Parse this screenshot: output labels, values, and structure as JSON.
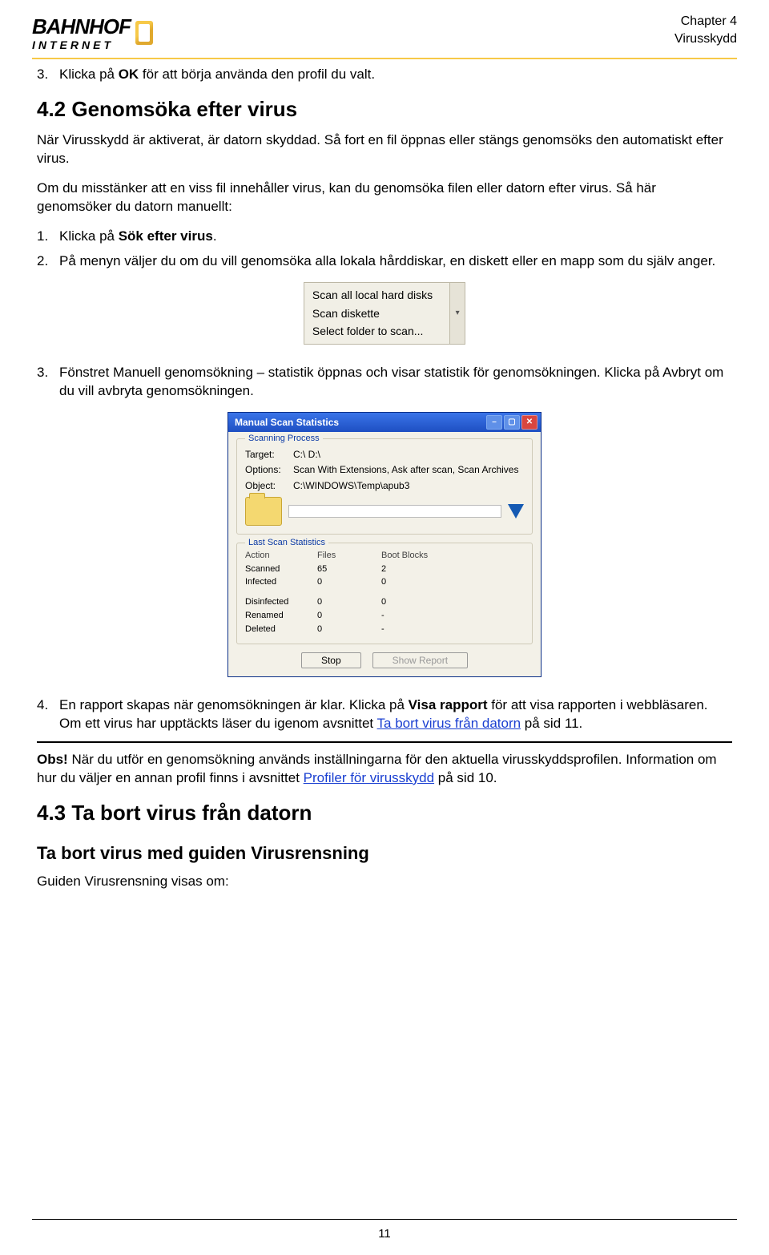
{
  "header": {
    "logo_main": "BAHNHOF",
    "logo_sub": "INTERNET",
    "chapter": "Chapter 4",
    "section": "Virusskydd"
  },
  "step3_pre": "Klicka på ",
  "step3_bold": "OK",
  "step3_post": " för att börja använda den profil du valt.",
  "h42": "4.2 Genomsöka efter virus",
  "p42": "När Virusskydd är aktiverat, är datorn skyddad. Så fort en fil öppnas eller stängs genomsöks den automatiskt efter virus.",
  "p42b": "Om du misstänker att en viss fil innehåller virus, kan du genomsöka filen eller datorn efter virus. Så här genomsöker du datorn manuellt:",
  "step1_pre": "Klicka på ",
  "step1_bold": "Sök efter virus",
  "step1_post": ".",
  "step2": "På menyn väljer du om du vill genomsöka alla lokala hårddiskar, en diskett eller en mapp som du själv anger.",
  "scan_menu": {
    "opt1": "Scan all local hard disks",
    "opt2": "Scan diskette",
    "opt3": "Select folder to scan..."
  },
  "step3b": "Fönstret Manuell genomsökning – statistik öppnas och visar statistik för genomsökningen. Klicka på Avbryt om du vill avbryta genomsökningen.",
  "win": {
    "title": "Manual Scan Statistics",
    "group1": "Scanning Process",
    "target_k": "Target:",
    "target_v": "C:\\ D:\\",
    "options_k": "Options:",
    "options_v": "Scan With Extensions, Ask after scan, Scan Archives",
    "object_k": "Object:",
    "object_v": "C:\\WINDOWS\\Temp\\apub3",
    "group2": "Last Scan Statistics",
    "stats": {
      "h_action": "Action",
      "h_files": "Files",
      "h_boot": "Boot Blocks",
      "rows": [
        {
          "a": "Scanned",
          "f": "65",
          "b": "2"
        },
        {
          "a": "Infected",
          "f": "0",
          "b": "0"
        },
        {
          "a": "Disinfected",
          "f": "0",
          "b": "0"
        },
        {
          "a": "Renamed",
          "f": "0",
          "b": "-"
        },
        {
          "a": "Deleted",
          "f": "0",
          "b": "-"
        }
      ]
    },
    "btn_stop": "Stop",
    "btn_report": "Show Report"
  },
  "step4_pre": "En rapport skapas när genomsökningen är klar. Klicka på ",
  "step4_bold": "Visa rapport",
  "step4_mid": " för att visa rapporten i webbläsaren. Om ett virus har upptäckts läser du igenom avsnittet ",
  "step4_link": "Ta bort virus från datorn",
  "step4_post": " på sid 11.",
  "obs_bold": "Obs!",
  "obs_mid": " När du utför en genomsökning används inställningarna för den aktuella virusskyddsprofilen. Information om hur du väljer en annan profil finns i avsnittet ",
  "obs_link": "Profiler för virusskydd",
  "obs_post": " på sid 10.",
  "h43": "4.3 Ta bort virus från datorn",
  "h43b": "Ta bort virus med guiden Virusrensning",
  "p43": "Guiden Virusrensning visas om:",
  "page_num": "11"
}
